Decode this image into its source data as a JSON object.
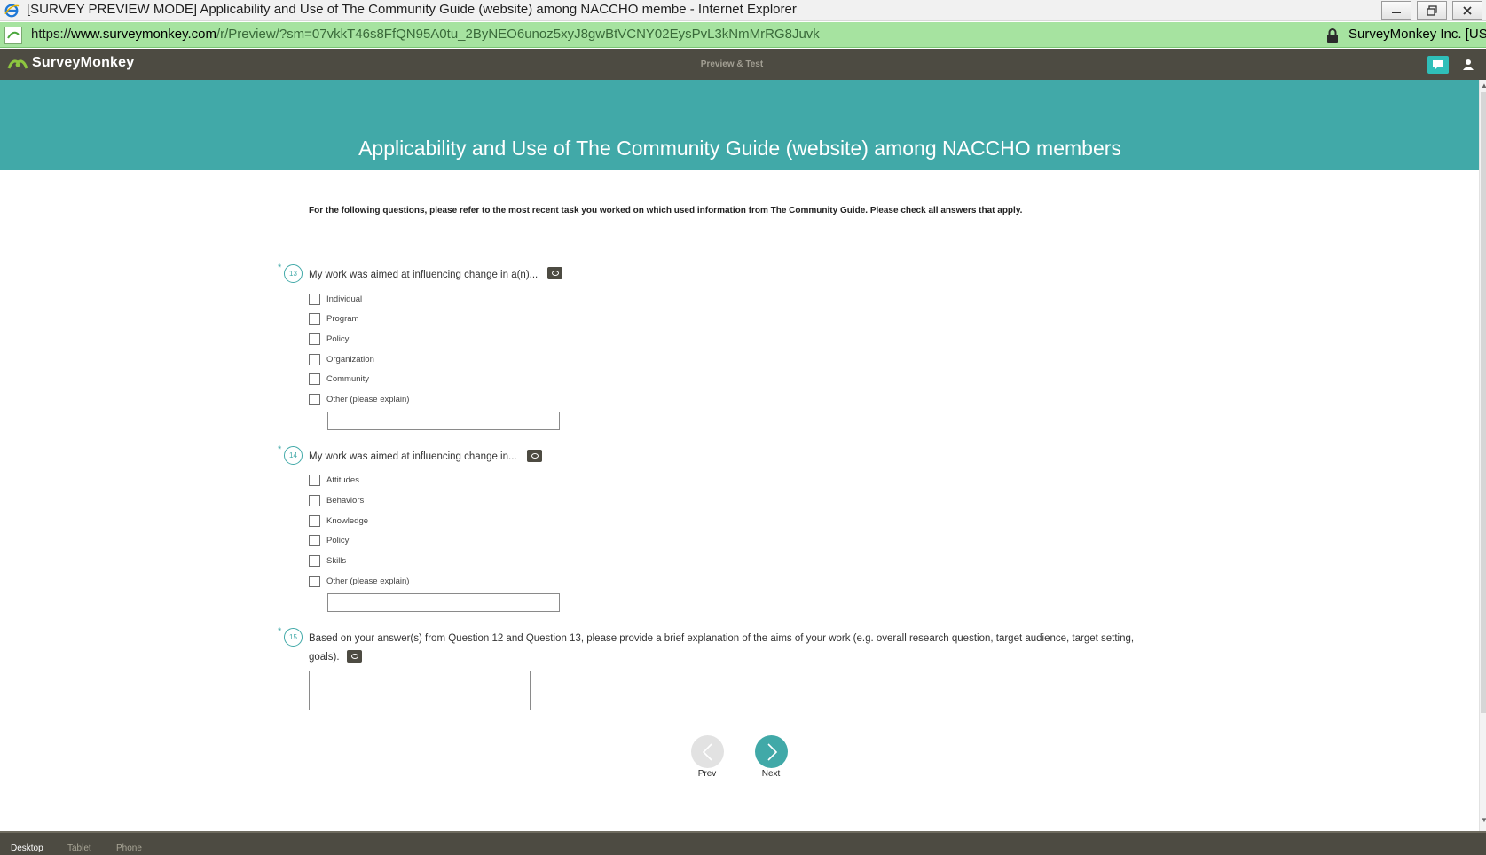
{
  "window": {
    "title": "[SURVEY PREVIEW MODE] Applicability and Use of The Community Guide (website) among NACCHO membe - Internet Explorer"
  },
  "address": {
    "scheme": "https://",
    "host": "www.surveymonkey.com",
    "path": "/r/Preview/?sm=07vkkT46s8FfQN95A0tu_2ByNEO6unoz5xyJ8gwBtVCNY02EysPvL3kNmMrRG8Juvk",
    "certificate": "SurveyMonkey Inc. [US]"
  },
  "header": {
    "logo": "SurveyMonkey",
    "logo_mark": "·",
    "mode_label": "Preview & Test"
  },
  "survey": {
    "title": "Applicability and Use of The Community Guide (website) among NACCHO members",
    "instructions": "For the following questions, please refer to the most recent task you worked on which used information from The Community Guide. Please check all answers that apply.",
    "questions": [
      {
        "number": "13",
        "required": "*",
        "text": "My work was aimed at influencing change in a(n)...",
        "options": [
          "Individual",
          "Program",
          "Policy",
          "Organization",
          "Community",
          "Other (please explain)"
        ]
      },
      {
        "number": "14",
        "required": "*",
        "text": "My work was aimed at influencing change in...",
        "options": [
          "Attitudes",
          "Behaviors",
          "Knowledge",
          "Policy",
          "Skills",
          "Other (please explain)"
        ]
      },
      {
        "number": "15",
        "required": "*",
        "text": "Based on your answer(s) from Question 12 and Question 13, please provide a brief explanation of the aims of your work (e.g. overall research question, target audience, target setting, goals)."
      }
    ],
    "nav": {
      "prev": "Prev",
      "next": "Next"
    }
  },
  "device_bar": {
    "desktop": "Desktop",
    "tablet": "Tablet",
    "phone": "Phone",
    "active": "desktop"
  },
  "colors": {
    "accent": "#41a9a8",
    "header_bg": "#4d4b42",
    "address_bg": "#a6e3a0",
    "chat_btn": "#2fbfb9"
  },
  "icons": [
    "internet-explorer-icon",
    "minimize-icon",
    "restore-icon",
    "close-icon",
    "page-icon",
    "lock-icon",
    "surveymonkey-logo-icon",
    "chat-icon",
    "user-icon",
    "comment-icon",
    "chevron-left-icon",
    "chevron-right-icon"
  ]
}
